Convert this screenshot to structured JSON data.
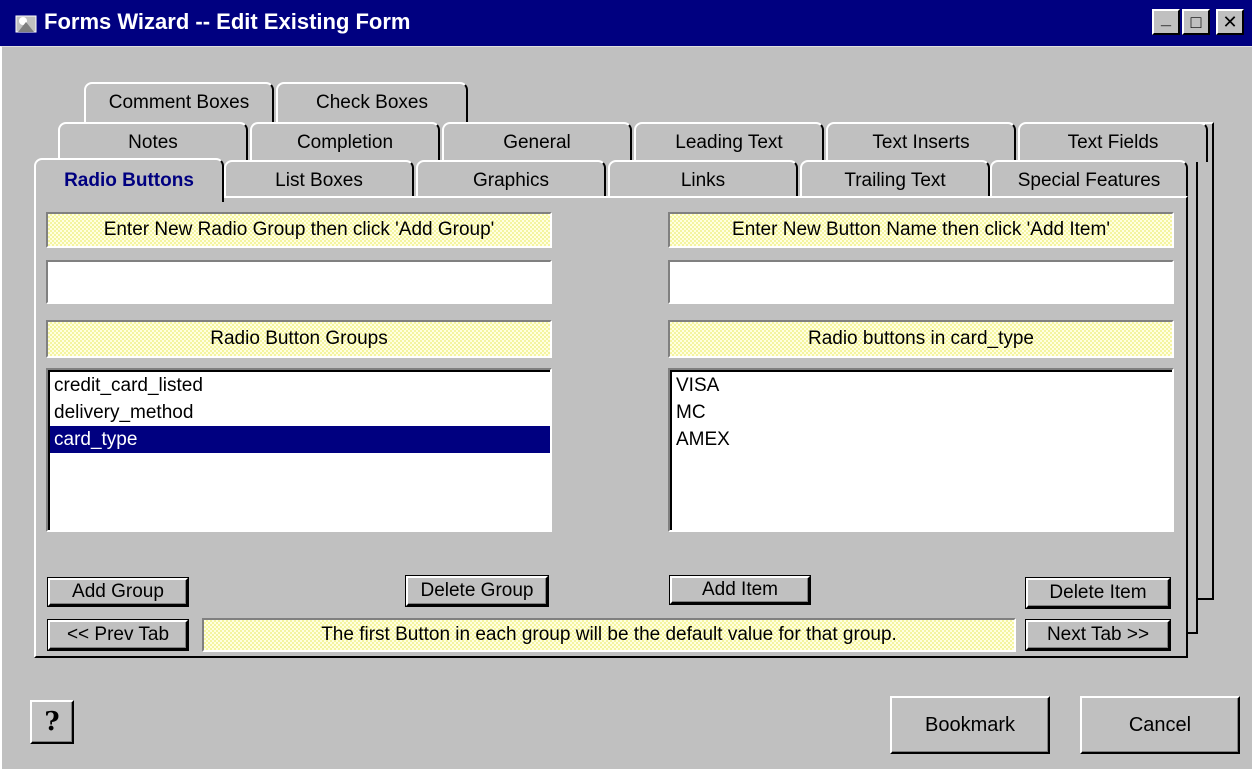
{
  "window": {
    "title": "Forms Wizard -- Edit Existing Form",
    "minimize": "_",
    "maximize": "□",
    "close": "✕"
  },
  "tabs": {
    "row3": [
      "Comment Boxes",
      "Check Boxes"
    ],
    "row2": [
      "Notes",
      "Completion",
      "General",
      "Leading Text",
      "Text Inserts",
      "Text Fields"
    ],
    "row1": [
      "Radio Buttons",
      "List Boxes",
      "Graphics",
      "Links",
      "Trailing Text",
      "Special Features"
    ],
    "active": "Radio Buttons"
  },
  "left": {
    "instruction": "Enter New Radio Group then click 'Add Group'",
    "input_value": "",
    "list_header": "Radio Button Groups",
    "groups": [
      "credit_card_listed",
      "delivery_method",
      "card_type"
    ],
    "selected_index": 2,
    "add_button": "Add Group",
    "delete_button": "Delete Group"
  },
  "right": {
    "instruction": "Enter New Button Name then click 'Add Item'",
    "input_value": "",
    "list_header": "Radio buttons in card_type",
    "items": [
      "VISA",
      "MC",
      "AMEX"
    ],
    "add_button": "Add Item",
    "delete_button": "Delete Item"
  },
  "footer": {
    "prev_tab": "<< Prev Tab",
    "note": "The first Button in each group will be the default value for that group.",
    "next_tab": "Next Tab >>"
  },
  "bottom": {
    "help_glyph": "?",
    "bookmark": "Bookmark",
    "cancel": "Cancel"
  },
  "colors": {
    "titlebar": "#000080",
    "face": "#c0c0c0",
    "selection": "#000080",
    "label_bg": "#ffffc8"
  }
}
